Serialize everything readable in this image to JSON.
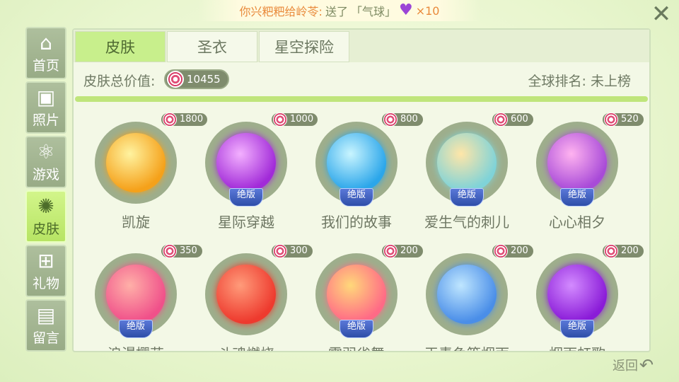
{
  "banner": {
    "sender": "你兴粑粑给岭苓:",
    "action": "送了",
    "gift": "「气球」",
    "heart_icon": "heart-balloon-icon",
    "count": "×10"
  },
  "close_icon": "close-icon",
  "sidebar": {
    "items": [
      {
        "label": "首页",
        "icon": "home-icon",
        "glyph": "⌂"
      },
      {
        "label": "照片",
        "icon": "photo-icon",
        "glyph": "▣"
      },
      {
        "label": "游戏",
        "icon": "atom-icon",
        "glyph": "⚛"
      },
      {
        "label": "皮肤",
        "icon": "skin-icon",
        "glyph": "✺"
      },
      {
        "label": "礼物",
        "icon": "gift-icon",
        "glyph": "⊞"
      },
      {
        "label": "留言",
        "icon": "message-icon",
        "glyph": "▤"
      }
    ],
    "active_index": 3
  },
  "tabs": [
    {
      "label": "皮肤"
    },
    {
      "label": "圣衣"
    },
    {
      "label": "星空探险"
    }
  ],
  "summary": {
    "label": "皮肤总价值:",
    "total": "10455",
    "rank": "全球排名: 未上榜"
  },
  "skins": [
    {
      "name": "凯旋",
      "price": "1800",
      "badge": "",
      "color1": "#fff3a0",
      "color2": "#f5a11a"
    },
    {
      "name": "星际穿越",
      "price": "1000",
      "badge": "绝版",
      "color1": "#f3b0ff",
      "color2": "#a12ad8"
    },
    {
      "name": "我们的故事",
      "price": "800",
      "badge": "绝版",
      "color1": "#c9f5ff",
      "color2": "#2ba6ea"
    },
    {
      "name": "爱生气的刺儿",
      "price": "600",
      "badge": "绝版",
      "color1": "#ffe6a8",
      "color2": "#7fd3d8"
    },
    {
      "name": "心心相夕",
      "price": "520",
      "badge": "绝版",
      "color1": "#ffb3f0",
      "color2": "#a84ad8"
    },
    {
      "name": "浪漫樱花",
      "price": "350",
      "badge": "绝版",
      "color1": "#ffb0a8",
      "color2": "#f0508a"
    },
    {
      "name": "斗魂燃烧",
      "price": "300",
      "badge": "",
      "color1": "#ff9b7a",
      "color2": "#ee3a2e"
    },
    {
      "name": "霞羽雀舞",
      "price": "200",
      "badge": "绝版",
      "color1": "#ffd87a",
      "color2": "#ff6a86"
    },
    {
      "name": "天青色等烟雨",
      "price": "200",
      "badge": "",
      "color1": "#bfe6ff",
      "color2": "#4a8ee8"
    },
    {
      "name": "烟雨虹歌",
      "price": "200",
      "badge": "绝版",
      "color1": "#d38bff",
      "color2": "#8a1bd8"
    }
  ],
  "back": {
    "label": "返回",
    "icon": "back-arrow-icon"
  }
}
